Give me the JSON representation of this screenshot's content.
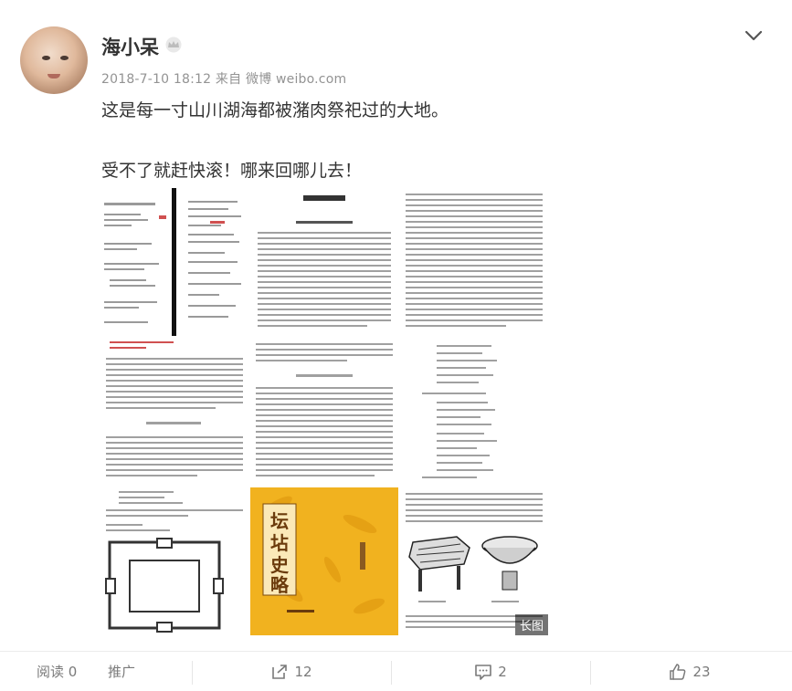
{
  "post": {
    "username": "海小呆",
    "meta": "2018-7-10 18:12 来自 微博 weibo.com",
    "line1": "这是每一寸山川湖海都被潴肉祭祀过的大地。",
    "line2": "受不了就赶快滚！哪来回哪儿去！",
    "long_image_badge": "长图",
    "book_cover_title": "坛坫史略"
  },
  "actions": {
    "read_label": "阅读 0",
    "promote_label": "推广",
    "share_count": "12",
    "comment_count": "2",
    "like_count": "23"
  },
  "colors": {
    "cover_yellow": "#f1b21f",
    "text_dark": "#333333",
    "meta_gray": "#939393"
  }
}
